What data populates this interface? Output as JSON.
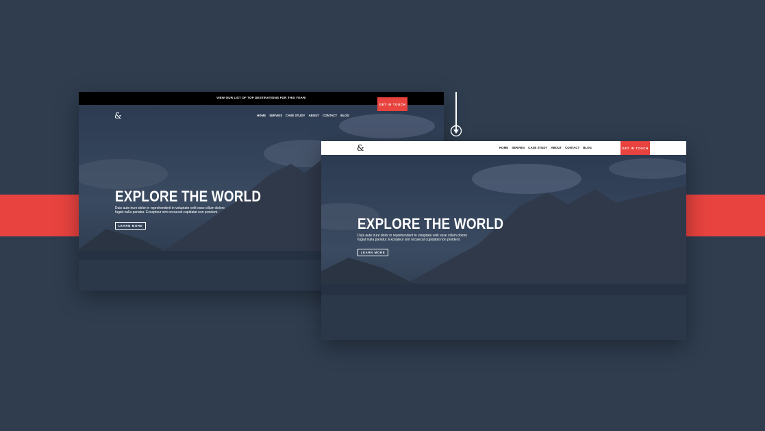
{
  "colors": {
    "page_background": "#2f3d4f",
    "accent_red": "#e8433f",
    "topbar_black": "#000000",
    "header_white": "#ffffff"
  },
  "before_screenshot": {
    "announcement": "VIEW OUR LIST OF TOP DESTINATIONS FOR THIS YEAR!",
    "cta_label": "GET IN TOUCH",
    "logo": "&",
    "nav": [
      "HOME",
      "SERVIES",
      "CASE STUDY",
      "ABOUT",
      "CONTACT",
      "BLOG"
    ],
    "hero_title": "EXPLORE THE WORLD",
    "hero_text": "Duis aute irure dolor in reprehenderit in voluptate velit esse cillum dolore fugiat nulla pariatur. Excepteur sint occaecat cupidatat non proident.",
    "button_label": "LEARN MORE"
  },
  "after_screenshot": {
    "cta_label": "GET IN TOUCH",
    "logo": "&",
    "nav": [
      "HOME",
      "SERVIES",
      "CASE STUDY",
      "ABOUT",
      "CONTACT",
      "BLOG"
    ],
    "hero_title": "EXPLORE THE WORLD",
    "hero_text": "Duis aute irure dolor in reprehenderit in voluptate velit esse cillum dolore fugiat nulla pariatur. Excepteur sint occaecat cupidatat non proident.",
    "button_label": "LEARN MORE"
  },
  "icons": {
    "transition_arrow": "arrow-down-circle-icon"
  }
}
